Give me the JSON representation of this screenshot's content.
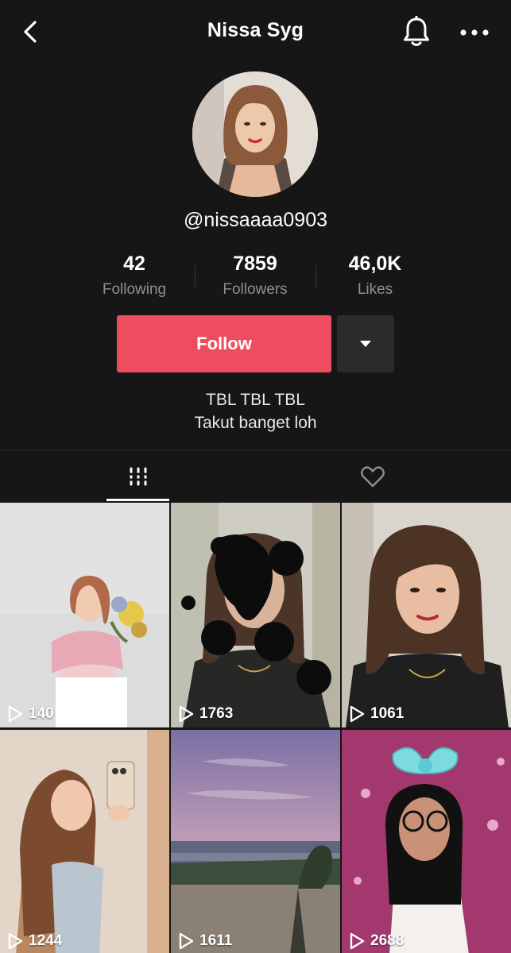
{
  "header": {
    "title": "Nissa Syg",
    "back_icon": "chevron-left-icon",
    "bell_icon": "bell-icon",
    "more_icon": "more-horizontal-icon"
  },
  "profile": {
    "username": "@nissaaaa0903",
    "stats": [
      {
        "value": "42",
        "label": "Following"
      },
      {
        "value": "7859",
        "label": "Followers"
      },
      {
        "value": "46,0K",
        "label": "Likes"
      }
    ],
    "follow_label": "Follow",
    "bio_lines": [
      "TBL TBL TBL",
      "Takut banget loh"
    ]
  },
  "tabs": [
    {
      "icon": "grid-icon",
      "active": true
    },
    {
      "icon": "heart-outline-icon",
      "active": false
    }
  ],
  "videos": [
    {
      "views": "140"
    },
    {
      "views": "1763"
    },
    {
      "views": "1061"
    },
    {
      "views": "1244"
    },
    {
      "views": "1611"
    },
    {
      "views": "2688"
    }
  ],
  "colors": {
    "background": "#161616",
    "follow_button": "#ee4d5f",
    "secondary_text": "#8f8f8f"
  }
}
